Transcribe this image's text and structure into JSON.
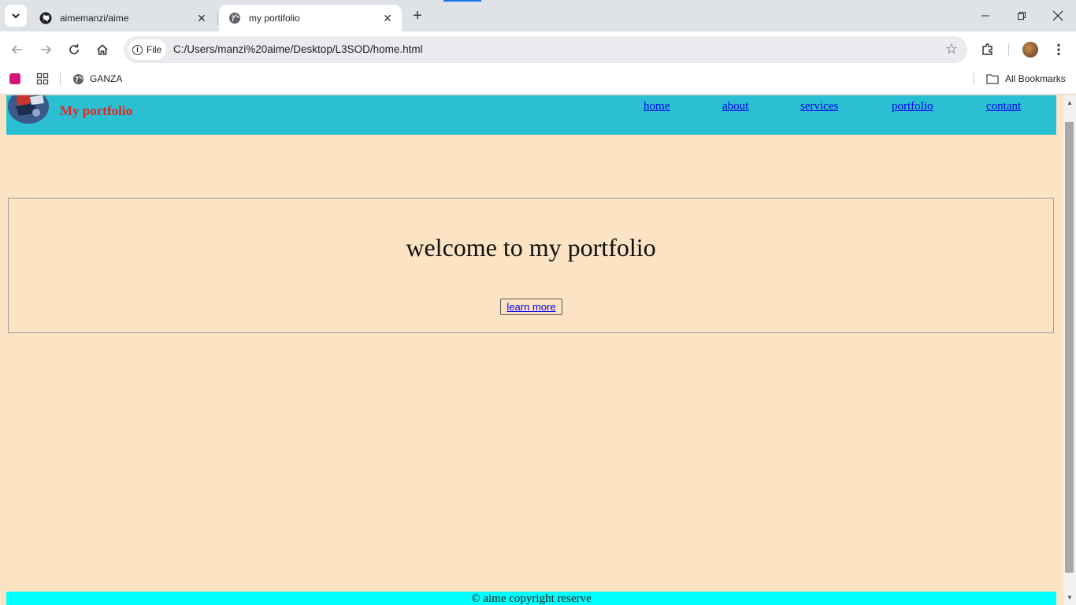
{
  "browser": {
    "tabs": [
      {
        "title": "aimemanzi/aime",
        "icon": "github-icon"
      },
      {
        "title": "my portifolio",
        "icon": "globe-icon"
      }
    ],
    "address": {
      "chip_label": "File",
      "url": "C:/Users/manzi%20aime/Desktop/L3SOD/home.html"
    },
    "bookmarks": {
      "items": [
        {
          "label": "GANZA"
        }
      ],
      "all_bookmarks_label": "All Bookmarks"
    }
  },
  "page": {
    "brand": "My portfolio",
    "nav": [
      "home",
      "about",
      "services",
      "portfolio",
      "contant"
    ],
    "hero_title": "welcome to my portfolio",
    "hero_button": "learn more",
    "footer": "© aime copyright reserve",
    "colors": {
      "background": "#fce3c4",
      "header": "#2bbfd4",
      "brand_text": "#e8231a",
      "link": "#0000ee",
      "footer": "#00ffff"
    }
  }
}
